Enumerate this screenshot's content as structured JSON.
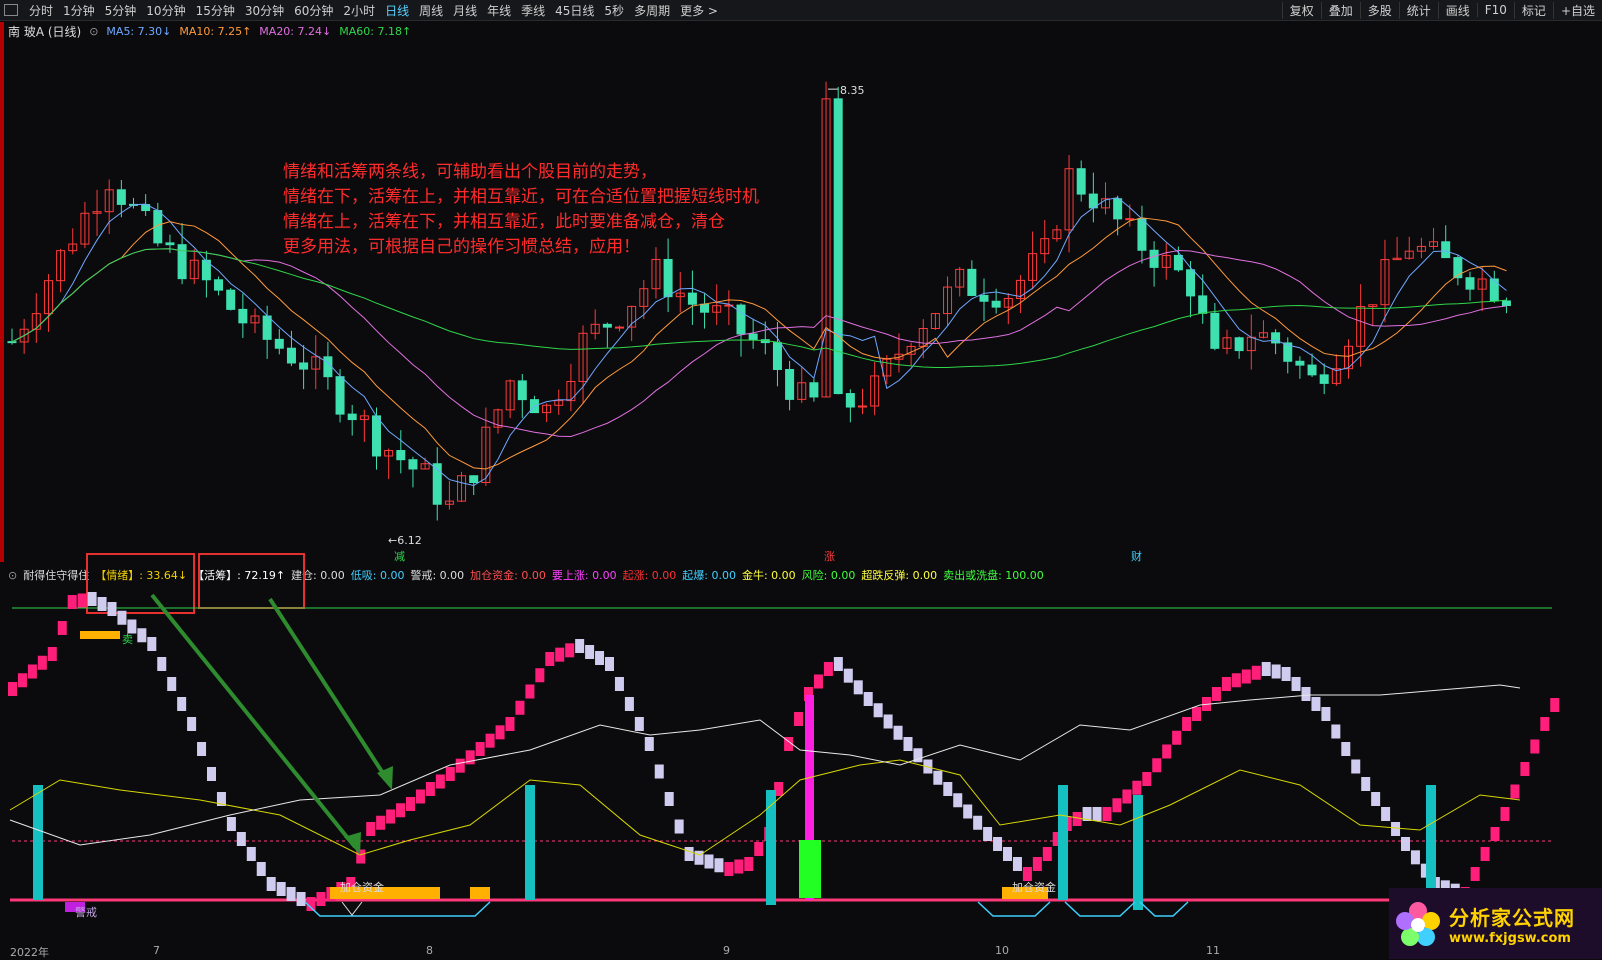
{
  "toolbar": {
    "periods": [
      "分时",
      "1分钟",
      "5分钟",
      "10分钟",
      "15分钟",
      "30分钟",
      "60分钟",
      "2小时",
      "日线",
      "周线",
      "月线",
      "年线",
      "季线",
      "45日线",
      "5秒",
      "多周期",
      "更多 >"
    ],
    "active_period": "日线",
    "right_tools": [
      "复权",
      "叠加",
      "多股",
      "统计",
      "画线",
      "F10",
      "标记",
      "+自选"
    ]
  },
  "stock": {
    "name": "南 玻A (日线)",
    "ma": [
      {
        "label": "MA5: 7.30↓",
        "color": "#6fa8ff"
      },
      {
        "label": "MA10: 7.25↑",
        "color": "#ff9a3c"
      },
      {
        "label": "MA20: 7.24↓",
        "color": "#e070e0"
      },
      {
        "label": "MA60: 7.18↑",
        "color": "#2fd64a"
      }
    ],
    "high_label": "8.35",
    "low_label": "6.12",
    "markers": {
      "reduce": "减",
      "rise": "涨",
      "finance": "财"
    }
  },
  "annotation": [
    "情绪和活筹两条线，可辅助看出个股目前的走势，",
    "情绪在下，活筹在上，并相互靠近，可在合适位置把握短线时机",
    "情绪在上，活筹在下，并相互靠近，此时要准备减仓，清仓",
    "更多用法，可根据自己的操作习惯总结，应用！"
  ],
  "indicator": {
    "name": "耐得住守得住",
    "items": [
      {
        "label": "【情绪】: 33.64↓",
        "color": "#f2d000"
      },
      {
        "label": "【活筹】: 72.19↑",
        "color": "#ffffff"
      },
      {
        "label": "建仓: 0.00",
        "color": "#dddddd"
      },
      {
        "label": "低吸: 0.00",
        "color": "#3fd0ff"
      },
      {
        "label": "警戒: 0.00",
        "color": "#dddddd"
      },
      {
        "label": "加仓资金: 0.00",
        "color": "#ff5050"
      },
      {
        "label": "要上涨: 0.00",
        "color": "#ff40ff"
      },
      {
        "label": "起涨: 0.00",
        "color": "#ff3030"
      },
      {
        "label": "起爆: 0.00",
        "color": "#3fd0ff"
      },
      {
        "label": "金牛: 0.00",
        "color": "#ffff40"
      },
      {
        "label": "风险: 0.00",
        "color": "#40ff40"
      },
      {
        "label": "超跌反弹: 0.00",
        "color": "#ffff40"
      },
      {
        "label": "卖出或洗盘: 100.00",
        "color": "#40ff40"
      }
    ],
    "labels": {
      "add_fund": "加仓资金",
      "warn": "警戒",
      "sell": "卖"
    }
  },
  "xaxis": [
    "2022年",
    "7",
    "8",
    "9",
    "10",
    "11"
  ],
  "logo": {
    "title": "分析家公式网",
    "url": "www.fxjgsw.com"
  },
  "colors": {
    "up": "#ff3a3a",
    "down": "#3fe0b0",
    "bg": "#0b0b0d",
    "pink": "#ff1f7a",
    "lavender": "#d0ccf0",
    "teal": "#17c0c0"
  }
}
